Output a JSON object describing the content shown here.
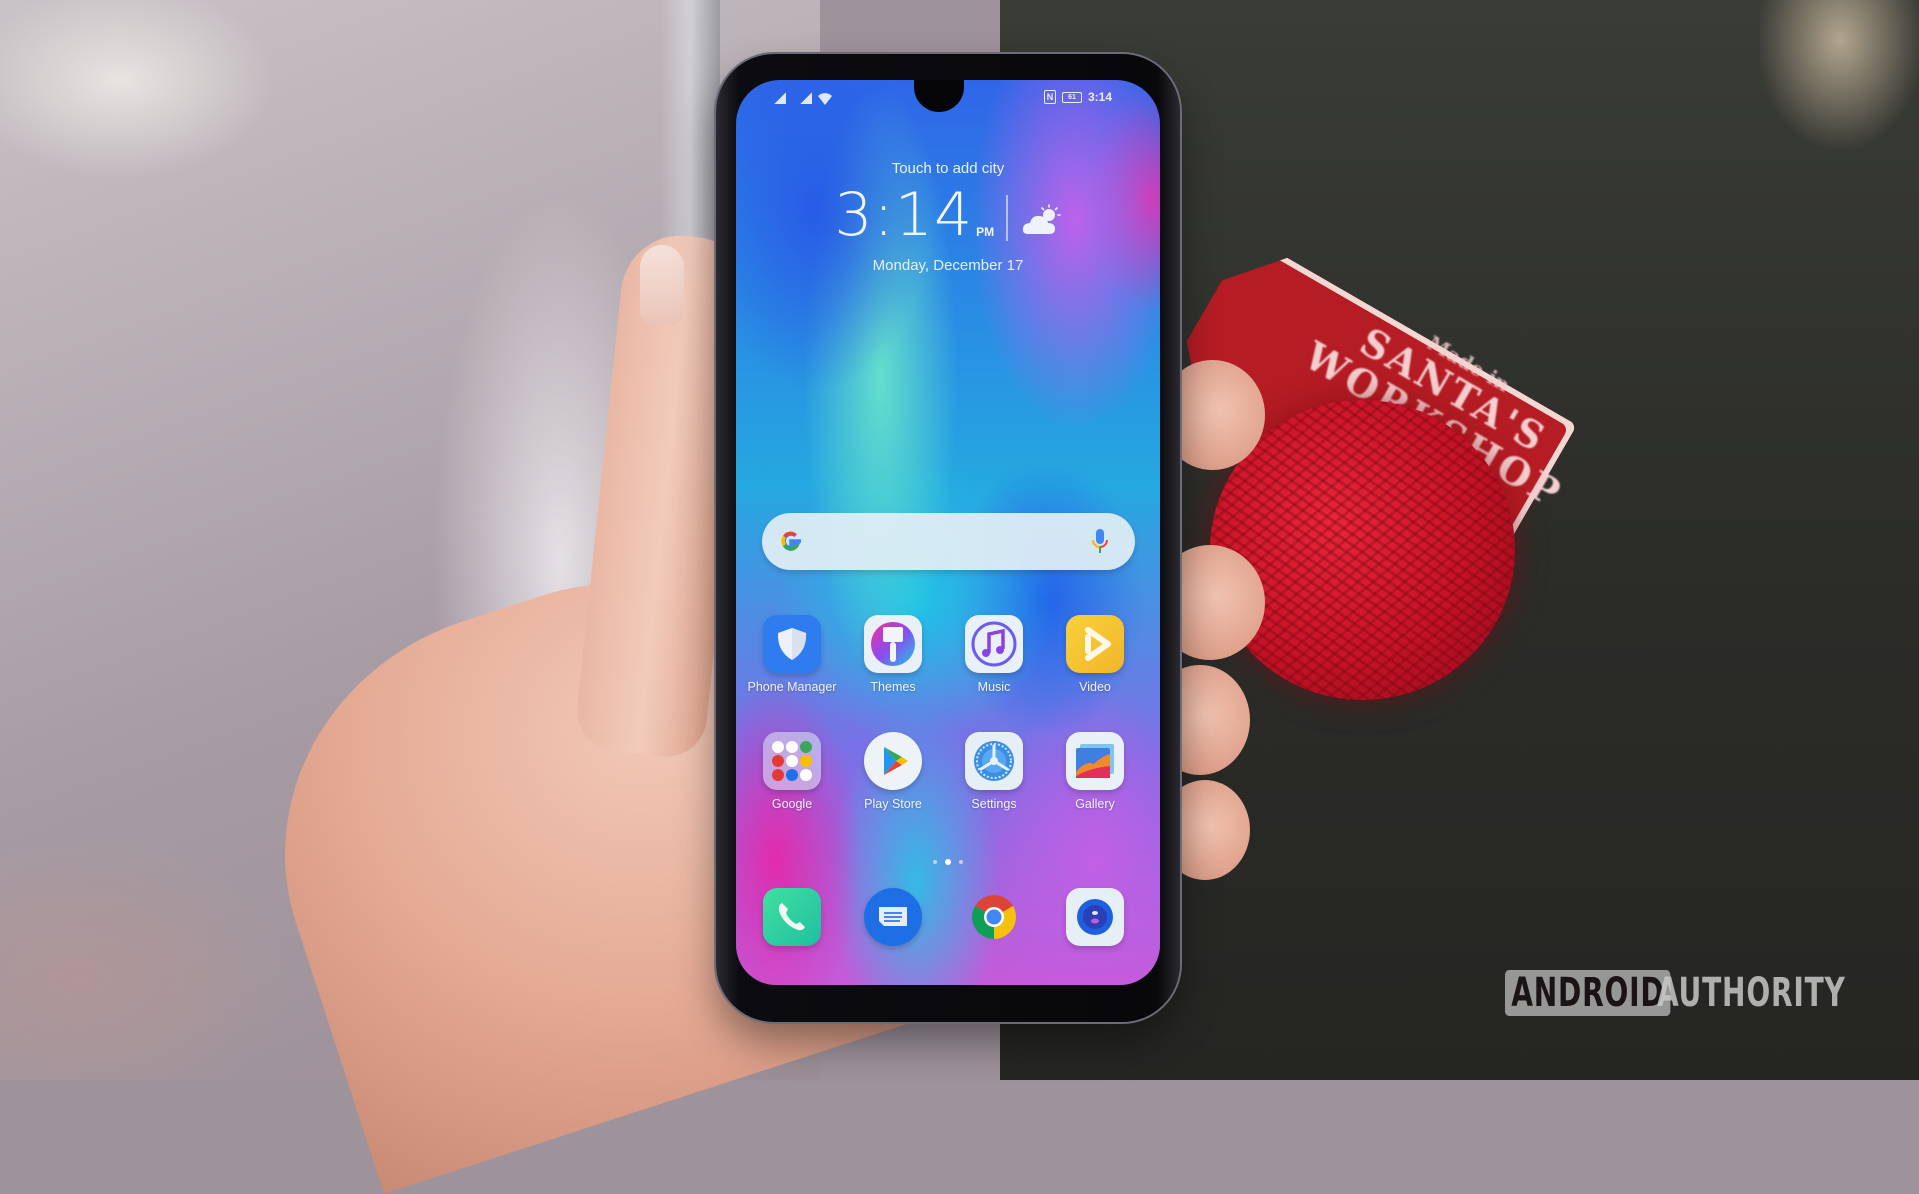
{
  "scene": {
    "description": "Hand holding smartphone showing home screen in front of Christmas tree",
    "tag_text": {
      "line1": "Made in",
      "line2": "SANTA'S",
      "line3": "WORKSHOP"
    },
    "watermark": {
      "boxed": "ANDROID",
      "plain": "AUTHORITY"
    }
  },
  "status_bar": {
    "icons_left": [
      "signal-icon",
      "signal-icon",
      "wifi-icon"
    ],
    "icons_right": [
      "nfc-icon",
      "battery-icon"
    ],
    "nfc_label": "N",
    "battery_label": "61",
    "time": "3:14"
  },
  "lock_widget": {
    "city_prompt": "Touch to add city",
    "time": "3:14",
    "ampm": "PM",
    "weather": "partly-cloudy-icon",
    "date": "Monday, December 17"
  },
  "search_bar": {
    "left_icon": "google-g-icon",
    "right_icon": "microphone-icon",
    "placeholder": ""
  },
  "apps": [
    {
      "label": "Phone Manager",
      "icon": "shield-icon"
    },
    {
      "label": "Themes",
      "icon": "paintbrush-icon"
    },
    {
      "label": "Music",
      "icon": "music-note-icon"
    },
    {
      "label": "Video",
      "icon": "play-icon"
    },
    {
      "label": "Google",
      "icon": "folder-icon"
    },
    {
      "label": "Play Store",
      "icon": "play-store-icon"
    },
    {
      "label": "Settings",
      "icon": "gear-icon"
    },
    {
      "label": "Gallery",
      "icon": "gallery-icon"
    }
  ],
  "page_indicator": {
    "pages": 3,
    "active": 2
  },
  "dock": [
    {
      "icon": "phone-icon",
      "name": "Phone"
    },
    {
      "icon": "messages-icon",
      "name": "Messages"
    },
    {
      "icon": "chrome-icon",
      "name": "Chrome"
    },
    {
      "icon": "camera-icon",
      "name": "Camera"
    }
  ],
  "colors": {
    "phone_manager": "#2f7cf0",
    "video": "#f5c829",
    "phone_app": "#2ec99b",
    "messages": "#1e6fe6"
  }
}
